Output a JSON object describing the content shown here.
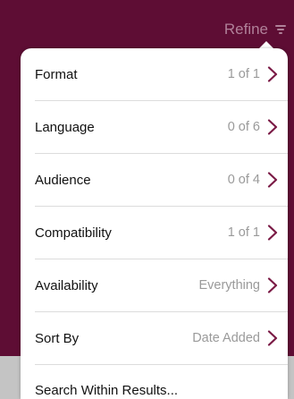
{
  "header": {
    "refine_label": "Refine"
  },
  "colors": {
    "accent": "#7a1a45",
    "header_bg": "#5e0d34"
  },
  "menu": {
    "items": [
      {
        "label": "Format",
        "value": "1 of 1"
      },
      {
        "label": "Language",
        "value": "0 of 6"
      },
      {
        "label": "Audience",
        "value": "0 of 4"
      },
      {
        "label": "Compatibility",
        "value": "1 of 1"
      },
      {
        "label": "Availability",
        "value": "Everything"
      },
      {
        "label": "Sort By",
        "value": "Date Added"
      }
    ],
    "search_label": "Search Within Results..."
  }
}
